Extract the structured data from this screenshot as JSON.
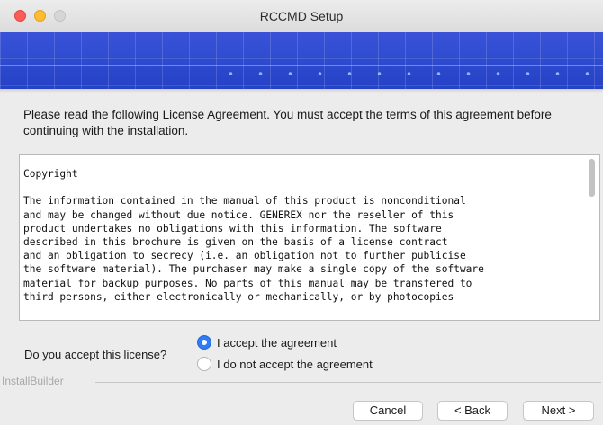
{
  "window": {
    "title": "RCCMD Setup"
  },
  "intro": {
    "text": "Please read the following License Agreement. You must accept the terms of this agreement before continuing with the installation."
  },
  "license": {
    "lines": [
      "Copyright",
      "",
      "The information contained in the manual of this product is nonconditional",
      "and may be changed without due notice. GENEREX nor the reseller of this",
      "product undertakes no obligations with this information. The software",
      "described in this brochure is given on the basis of a license contract",
      "and an obligation to secrecy (i.e. an obligation not to further publicise",
      "the software material). The purchaser may make a single copy of the software",
      "material for backup purposes. No parts of this manual may be transfered to",
      "third persons, either electronically or mechanically, or by photocopies"
    ]
  },
  "acceptance": {
    "question": "Do you accept this license?",
    "options": [
      {
        "label": "I accept the agreement",
        "selected": true
      },
      {
        "label": "I do not accept the agreement",
        "selected": false
      }
    ]
  },
  "footer": {
    "brand": "InstallBuilder",
    "cancel_label": "Cancel",
    "back_label": "< Back",
    "next_label": "Next >"
  },
  "colors": {
    "banner": "#2f4ccf",
    "radio_selected": "#2e7cf6"
  }
}
